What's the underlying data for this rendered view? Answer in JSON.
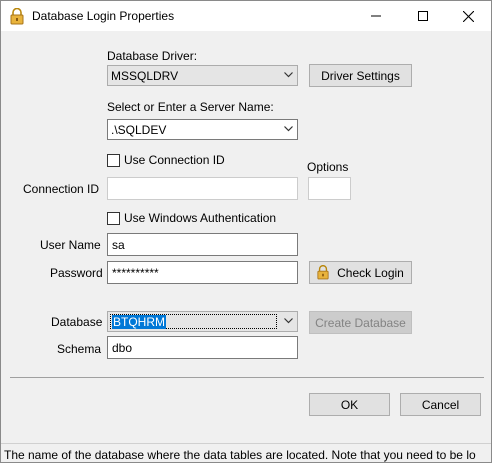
{
  "window": {
    "title": "Database Login Properties",
    "icon": "lock-icon"
  },
  "title_buttons": {
    "minimize": "minimize-icon",
    "maximize": "maximize-icon",
    "close": "close-icon"
  },
  "driver": {
    "label": "Database Driver:",
    "value": "MSSQLDRV",
    "settings_button": "Driver Settings"
  },
  "server": {
    "label": "Select or Enter a Server Name:",
    "value": ".\\SQLDEV"
  },
  "connection": {
    "use_connection_id_label": "Use Connection ID",
    "use_connection_id_checked": false,
    "options_label": "Options",
    "connection_id_label": "Connection ID",
    "connection_id_value": "",
    "options_value": ""
  },
  "auth": {
    "use_windows_auth_label": "Use Windows Authentication",
    "use_windows_auth_checked": false,
    "user_name_label": "User Name",
    "user_name_value": "sa",
    "password_label": "Password",
    "password_value": "**********",
    "check_login_button": "Check Login"
  },
  "database": {
    "label": "Database",
    "value": "BTQHRM",
    "create_button": "Create Database",
    "schema_label": "Schema",
    "schema_value": "dbo"
  },
  "actions": {
    "ok": "OK",
    "cancel": "Cancel"
  },
  "status": {
    "text": "The name of the database where the data tables are located. Note that you need to be lo"
  },
  "colors": {
    "window_bg": "#f0f0f0",
    "titlebar_bg": "#ffffff",
    "button_bg": "#e1e1e1",
    "selection": "#0078d7",
    "lock_gold": "#e0a32b"
  }
}
